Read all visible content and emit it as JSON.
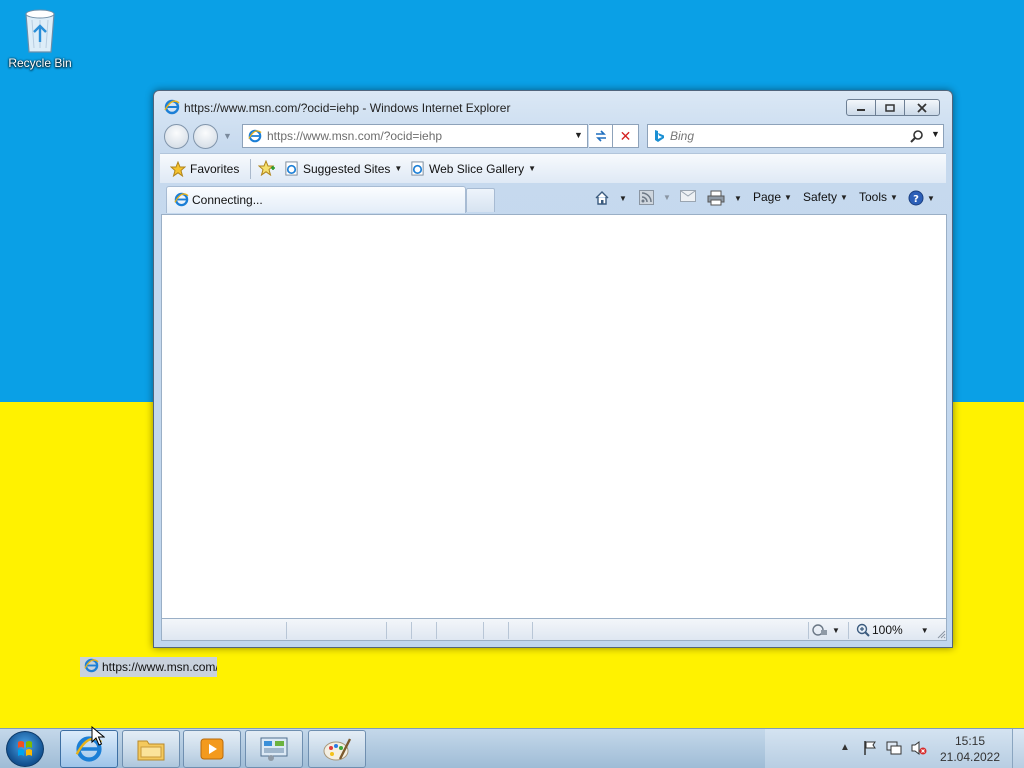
{
  "desktop": {
    "icons": [
      {
        "label": "Recycle Bin",
        "icon": "recycle-bin-icon"
      }
    ]
  },
  "window": {
    "title": "https://www.msn.com/?ocid=iehp - Windows Internet Explorer",
    "address": "https://www.msn.com/?ocid=iehp",
    "search_placeholder": "Bing",
    "favorites_bar": {
      "favorites_label": "Favorites",
      "items": [
        "Suggested Sites",
        "Web Slice Gallery"
      ]
    },
    "tab": {
      "label": "Connecting..."
    },
    "command_bar": {
      "page_label": "Page",
      "safety_label": "Safety",
      "tools_label": "Tools"
    },
    "status_bar": {
      "zoom": "100%"
    }
  },
  "drag_ghost": {
    "text": "https://www.msn.com/"
  },
  "taskbar": {
    "buttons": [
      "Internet Explorer",
      "Windows Explorer",
      "Windows Media Player",
      "Control Panel",
      "Paint"
    ],
    "active": "Internet Explorer",
    "clock_time": "15:15",
    "clock_date": "21.04.2022"
  }
}
